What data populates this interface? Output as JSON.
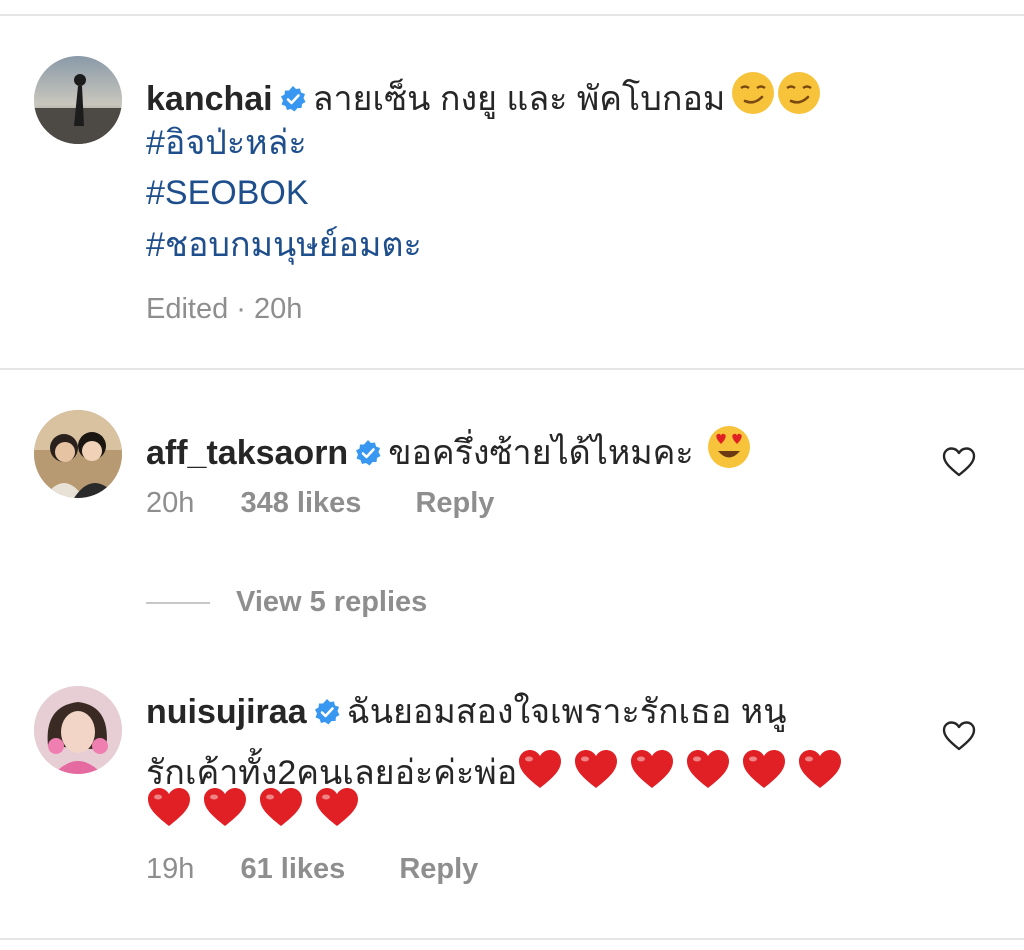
{
  "post": {
    "username": "kanchai",
    "caption": "ลายเซ็น กงยู และ พัคโบกอม",
    "emojis": [
      "smirk",
      "smirk"
    ],
    "hashtags": [
      "#อิจป่ะหล่ะ",
      "#SEOBOK",
      "#ชอบกมนุษย์อมตะ"
    ],
    "edited_label": "Edited · 20h"
  },
  "comments": [
    {
      "username": "aff_taksaorn",
      "text": "ขอครึ่งซ้ายได้ไหมคะ",
      "emojis": [
        "heart-eyes"
      ],
      "time": "20h",
      "likes": "348 likes",
      "reply": "Reply",
      "view_replies": "View 5 replies"
    },
    {
      "username": "nuisujiraa",
      "text_line1": "ฉันยอมสองใจเพราะรักเธอ หนู",
      "text_line2": "รักเค้าทั้ง2คนเลยอ่ะค่ะพ่อ",
      "heart_count": 10,
      "time": "19h",
      "likes": "61 likes",
      "reply": "Reply"
    }
  ],
  "colors": {
    "verified": "#3897f0",
    "hashtag": "#1e4f8c",
    "meta": "#8e8e8e",
    "heart": "#e02024"
  }
}
